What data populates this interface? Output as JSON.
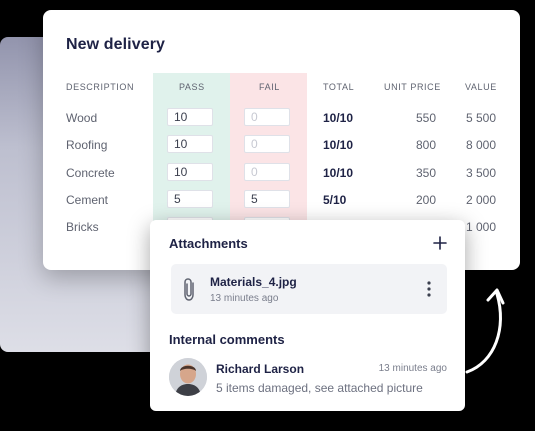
{
  "delivery": {
    "title": "New delivery",
    "headers": {
      "description": "DESCRIPTION",
      "pass": "PASS",
      "fail": "FAIL",
      "total": "TOTAL",
      "unit_price": "UNIT PRICE",
      "value": "VALUE"
    },
    "rows": [
      {
        "description": "Wood",
        "pass": "10",
        "fail": "0",
        "total": "10/10",
        "unit_price": "550",
        "value": "5 500"
      },
      {
        "description": "Roofing",
        "pass": "10",
        "fail": "0",
        "total": "10/10",
        "unit_price": "800",
        "value": "8 000"
      },
      {
        "description": "Concrete",
        "pass": "10",
        "fail": "0",
        "total": "10/10",
        "unit_price": "350",
        "value": "3 500"
      },
      {
        "description": "Cement",
        "pass": "5",
        "fail": "5",
        "total": "5/10",
        "unit_price": "200",
        "value": "2 000"
      },
      {
        "description": "Bricks",
        "value": "1 000"
      }
    ],
    "colors": {
      "pass_column": "#e0f2ec",
      "fail_column": "#fbe4e6",
      "title": "#1e2245"
    }
  },
  "attachments": {
    "title": "Attachments",
    "add_icon": "plus-icon",
    "file": {
      "name": "Materials_4.jpg",
      "time": "13 minutes ago",
      "icon": "paperclip-icon",
      "menu_icon": "kebab-icon"
    }
  },
  "comments": {
    "title": "Internal comments",
    "items": [
      {
        "author": "Richard Larson",
        "time": "13 minutes ago",
        "text": "5 items damaged, see attached picture",
        "avatar": "avatar"
      }
    ]
  }
}
